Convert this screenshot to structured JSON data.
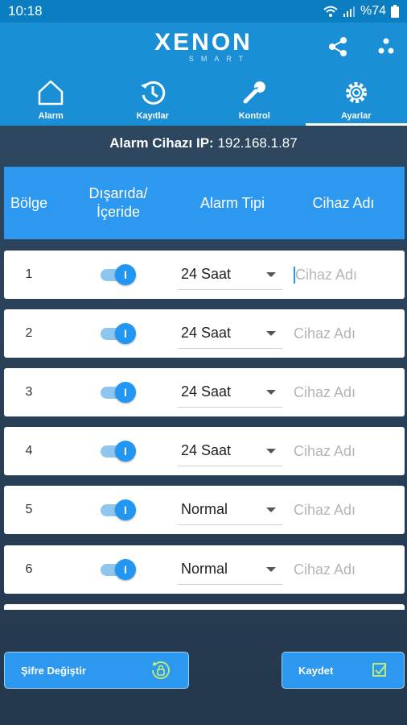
{
  "status_bar": {
    "time": "10:18",
    "battery": "%74"
  },
  "header": {
    "logo_main": "XENON",
    "logo_sub": "SMART",
    "tabs": [
      {
        "label": "Alarm",
        "icon": "home-icon",
        "active": false
      },
      {
        "label": "Kayıtlar",
        "icon": "history-icon",
        "active": false
      },
      {
        "label": "Kontrol",
        "icon": "wrench-icon",
        "active": false
      },
      {
        "label": "Ayarlar",
        "icon": "gear-icon",
        "active": true
      }
    ]
  },
  "ip": {
    "label": "Alarm Cihazı IP:",
    "value": "192.168.1.87"
  },
  "table": {
    "headers": [
      "Bölge",
      "Dışarıda/\nİçeride",
      "Alarm Tipi",
      "Cihaz Adı"
    ],
    "rows": [
      {
        "zone": "1",
        "toggle_on": true,
        "toggle_label": "I",
        "type": "24 Saat",
        "name_placeholder": "Cihaz Adı"
      },
      {
        "zone": "2",
        "toggle_on": true,
        "toggle_label": "I",
        "type": "24 Saat",
        "name_placeholder": "Cihaz Adı"
      },
      {
        "zone": "3",
        "toggle_on": true,
        "toggle_label": "I",
        "type": "24 Saat",
        "name_placeholder": "Cihaz Adı"
      },
      {
        "zone": "4",
        "toggle_on": true,
        "toggle_label": "I",
        "type": "24 Saat",
        "name_placeholder": "Cihaz Adı"
      },
      {
        "zone": "5",
        "toggle_on": true,
        "toggle_label": "I",
        "type": "Normal",
        "name_placeholder": "Cihaz Adı"
      },
      {
        "zone": "6",
        "toggle_on": true,
        "toggle_label": "I",
        "type": "Normal",
        "name_placeholder": "Cihaz Adı"
      }
    ]
  },
  "buttons": {
    "change_password": "Şifre Değiştir",
    "save": "Kaydet"
  },
  "colors": {
    "primary": "#1a8fd6",
    "table_header": "#2c98f0",
    "accent_icon": "#c8f06e",
    "background": "#2f4a63"
  }
}
